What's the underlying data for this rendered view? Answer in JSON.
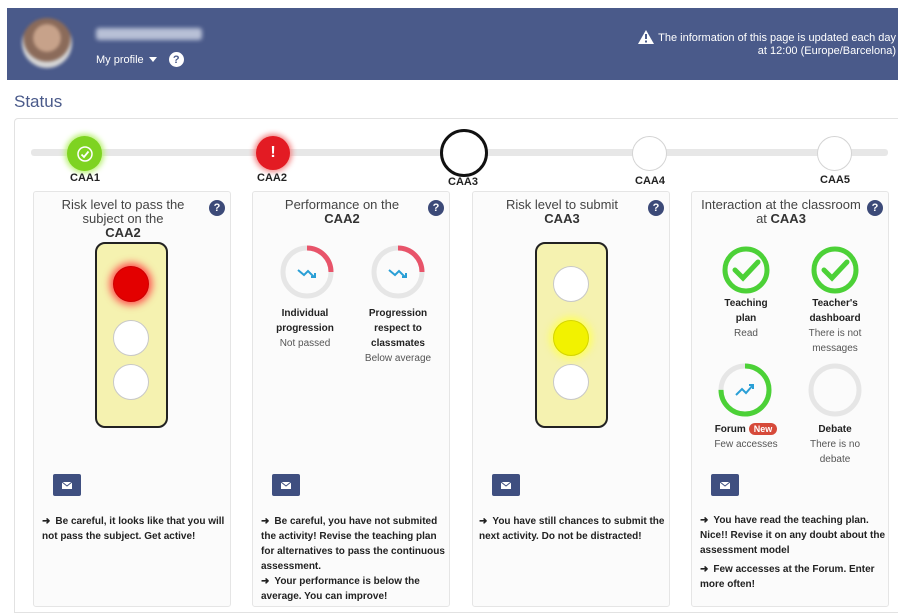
{
  "header": {
    "profile_label": "My profile",
    "info_line1": "The information of this page is updated each day",
    "info_line2": "at 12:00 (Europe/Barcelona)"
  },
  "status_title": "Status",
  "timeline": [
    "CAA1",
    "CAA2",
    "CAA3",
    "CAA4",
    "CAA5"
  ],
  "cards": {
    "risk_pass": {
      "title": "Risk level to pass the subject on the",
      "activity": "CAA2",
      "message": "Be careful, it looks like that you will not pass the subject. Get active!"
    },
    "performance": {
      "title": "Performance on the",
      "activity": "CAA2",
      "gauges": [
        {
          "name": "Individual progression",
          "status": "Not passed",
          "fill": 0.25
        },
        {
          "name": "Progression respect to classmates",
          "status": "Below average",
          "fill": 0.25
        }
      ],
      "messages": [
        "Be careful, you have not submited the activity! Revise the teaching plan for alternatives to pass the continuous assessment.",
        "Your performance is below the average. You can improve!"
      ]
    },
    "risk_submit": {
      "title": "Risk level to submit",
      "activity": "CAA3",
      "message": "You have still chances to submit the next activity. Do not be distracted!"
    },
    "interaction": {
      "title": "Interaction at the classroom at",
      "activity": "CAA3",
      "items": [
        {
          "name_line1": "Teaching",
          "name_line2": "plan",
          "status_line1": "Read",
          "status_line2": ""
        },
        {
          "name_line1": "Teacher's",
          "name_line2": "dashboard",
          "status_line1": "There is not",
          "status_line2": "messages"
        },
        {
          "name_line1": "Forum",
          "badge": "New",
          "status_line1": "Few accesses",
          "status_line2": ""
        },
        {
          "name_line1": "Debate",
          "status_line1": "There is no",
          "status_line2": "debate"
        }
      ],
      "messages": [
        "You have read the teaching plan. Nice!! Revise it on any doubt about the assessment model",
        "Few accesses at the Forum. Enter more often!"
      ]
    }
  },
  "colors": {
    "header": "#4a5a8a",
    "green": "#4cd137",
    "red": "#e53935",
    "yellow": "#f7f700",
    "gauge_red": "#e8546a",
    "trend_blue": "#2a9fd6"
  },
  "icons": {
    "help": "?",
    "arrow": "➜",
    "mail": "envelope-icon",
    "warning": "warning-icon",
    "check": "check-icon",
    "exclamation": "!"
  }
}
